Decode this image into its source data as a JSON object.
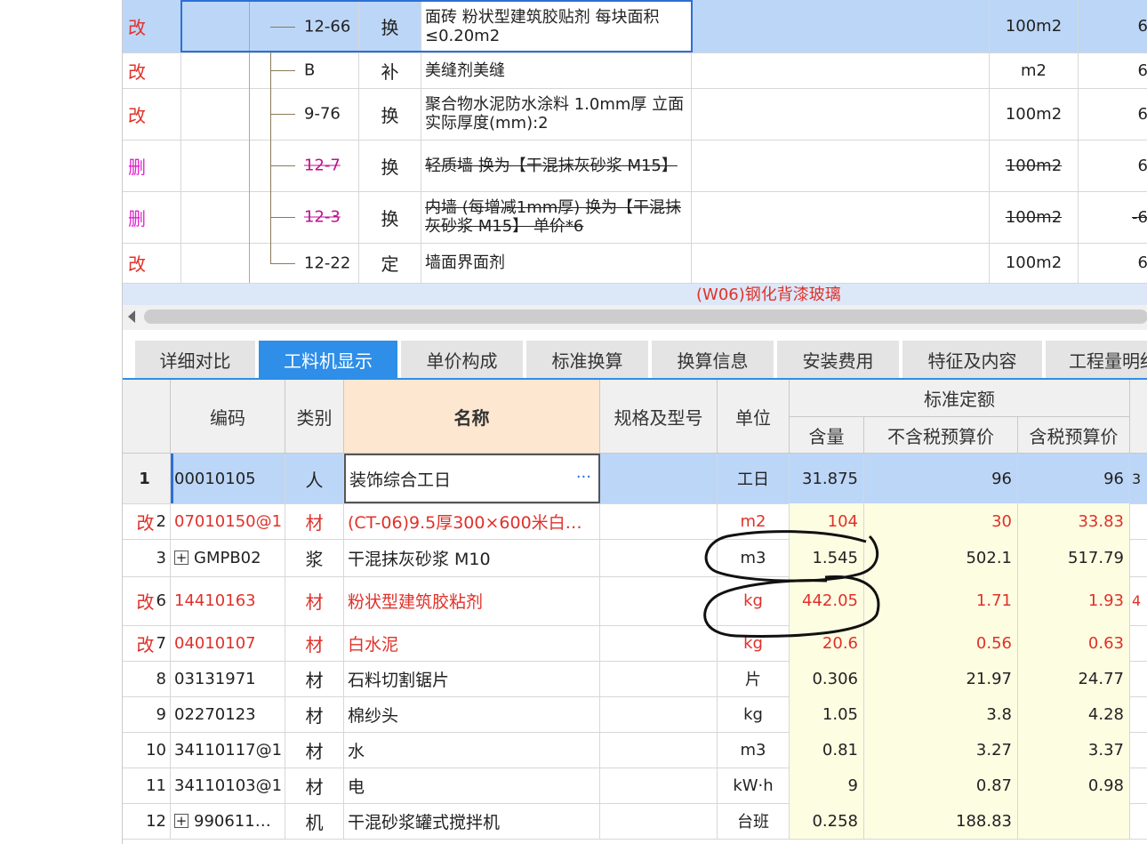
{
  "top_rows": [
    {
      "flag": "改",
      "code": "12-66",
      "type": "换",
      "name": "面砖 粉状型建筑胶贴剂 每块面积 ≤0.20m2",
      "unit": "100m2",
      "qty": "6",
      "selected": true
    },
    {
      "flag": "改",
      "code": "B",
      "type": "补",
      "name": "美缝剂美缝",
      "unit": "m2",
      "qty": "6"
    },
    {
      "flag": "改",
      "code": "9-76",
      "type": "换",
      "name": "聚合物水泥防水涂料 1.0mm厚 立面  实际厚度(mm):2",
      "unit": "100m2",
      "qty": "6"
    },
    {
      "flag": "删",
      "code": "12-7",
      "type": "换",
      "name": "轻质墙  换为【干混抹灰砂浆 M15】",
      "unit": "100m2",
      "qty": "6",
      "deleted": true
    },
    {
      "flag": "删",
      "code": "12-3",
      "type": "换",
      "name": "内墙 (每增减1mm厚) 换为【干混抹灰砂浆 M15】 单价*6",
      "unit": "100m2",
      "qty": "-6",
      "deleted": true
    },
    {
      "flag": "改",
      "code": "12-22",
      "type": "定",
      "name": "墙面界面剂",
      "unit": "100m2",
      "qty": "6"
    }
  ],
  "section_label": "(W06)钢化背漆玻璃",
  "tabs": [
    "详细对比",
    "工料机显示",
    "单价构成",
    "标准换算",
    "换算信息",
    "安装费用",
    "特征及内容",
    "工程量明细"
  ],
  "active_tab": 1,
  "headers": {
    "code": "编码",
    "category": "类别",
    "name": "名称",
    "spec": "规格及型号",
    "unit": "单位",
    "group": "标准定额",
    "qty": "含量",
    "price_excl": "不含税预算价",
    "price_incl": "含税预算价"
  },
  "rows": [
    {
      "flag": "",
      "num": "1",
      "code": "00010105",
      "cat": "人",
      "name": "装饰综合工日",
      "unit": "工日",
      "qty": "31.875",
      "p1": "96",
      "p2": "96",
      "extra": "3",
      "selected": true,
      "red": false
    },
    {
      "flag": "改",
      "num": "2",
      "code": "07010150@1",
      "cat": "材",
      "name": "(CT-06)9.5厚300×600米白…",
      "unit": "m2",
      "qty": "104",
      "p1": "30",
      "p2": "33.83",
      "extra": "",
      "red": true
    },
    {
      "flag": "",
      "num": "3",
      "code": "GMPB02",
      "cat": "浆",
      "name": "干混抹灰砂浆 M10",
      "unit": "m3",
      "qty": "1.545",
      "p1": "502.1",
      "p2": "517.79",
      "extra": "",
      "red": false,
      "expand": true
    },
    {
      "flag": "改",
      "num": "6",
      "code": "14410163",
      "cat": "材",
      "name": "粉状型建筑胶粘剂",
      "unit": "kg",
      "qty": "442.05",
      "p1": "1.71",
      "p2": "1.93",
      "extra": "4",
      "red": true
    },
    {
      "flag": "改",
      "num": "7",
      "code": "04010107",
      "cat": "材",
      "name": "白水泥",
      "unit": "kg",
      "qty": "20.6",
      "p1": "0.56",
      "p2": "0.63",
      "extra": "",
      "red": true
    },
    {
      "flag": "",
      "num": "8",
      "code": "03131971",
      "cat": "材",
      "name": "石料切割锯片",
      "unit": "片",
      "qty": "0.306",
      "p1": "21.97",
      "p2": "24.77",
      "extra": "",
      "red": false
    },
    {
      "flag": "",
      "num": "9",
      "code": "02270123",
      "cat": "材",
      "name": "棉纱头",
      "unit": "kg",
      "qty": "1.05",
      "p1": "3.8",
      "p2": "4.28",
      "extra": "",
      "red": false
    },
    {
      "flag": "",
      "num": "10",
      "code": "34110117@1",
      "cat": "材",
      "name": "水",
      "unit": "m3",
      "qty": "0.81",
      "p1": "3.27",
      "p2": "3.37",
      "extra": "",
      "red": false
    },
    {
      "flag": "",
      "num": "11",
      "code": "34110103@1",
      "cat": "材",
      "name": "电",
      "unit": "kW·h",
      "qty": "9",
      "p1": "0.87",
      "p2": "0.98",
      "extra": "",
      "red": false
    },
    {
      "flag": "",
      "num": "12",
      "code": "990611…",
      "cat": "机",
      "name": "干混砂浆罐式搅拌机",
      "unit": "台班",
      "qty": "0.258",
      "p1": "188.83",
      "p2": "",
      "extra": "",
      "red": false,
      "expand": true
    }
  ],
  "colors": {
    "accent": "#2e8ee8",
    "flag_red": "#e0312a",
    "flag_delete": "#e020d0",
    "selection": "#bcd6f7",
    "price_bg": "#fdfde2"
  }
}
